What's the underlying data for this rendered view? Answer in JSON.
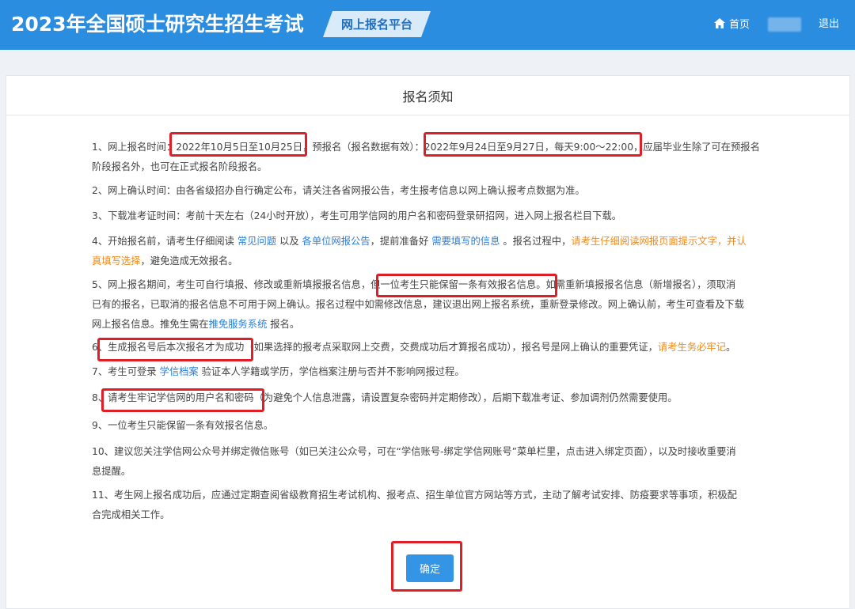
{
  "header": {
    "title": "2023年全国硕士研究生招生考试",
    "platform": "网上报名平台",
    "home_label": "首页",
    "logout_label": "退出"
  },
  "panel": {
    "title": "报名须知"
  },
  "notice": {
    "i1": {
      "a": "1、网上报名时间：",
      "b": "2022年10月5日至10月25日，",
      "c": "预报名（报名数据有效）：",
      "d": "2022年9月24日至9月27日，每天9:00～22:00，",
      "e": "应届毕业生除了可在预报名",
      "l2": "阶段报名外，也可在正式报名阶段报名。"
    },
    "i2": "2、网上确认时间：由各省级招办自行确定公布，请关注各省网报公告，考生报考信息以网上确认报考点数据为准。",
    "i3": "3、下载准考证时间：考前十天左右（24小时开放），考生可用学信网的用户名和密码登录研招网，进入网上报名栏目下载。",
    "i4": {
      "a": "4、开始报名前，请考生仔细阅读 ",
      "link1": "常见问题",
      "b": " 以及 ",
      "link2": "各单位网报公告",
      "c": "，提前准备好 ",
      "link3": "需要填写的信息",
      "d": " 。报名过程中，",
      "warn1": "请考生仔细阅读网报页面提示文字，并认",
      "warn2": "真填写选择",
      "e": "，避免造成无效报名。"
    },
    "i5": {
      "a": "5、网上报名期间，考生可自行填报、修改或重新填报报名信息，",
      "b": "但一位考生只能保留一条有效报名信息。",
      "c": "如需重新填报报名信息（新增报名），须取消",
      "l2": "已有的报名，已取消的报名信息不可用于网上确认。报名过程中如需修改信息，建议退出网上报名系统，重新登录修改。网上确认前，考生可查看及下载",
      "l3a": "网上报名信息。推免生需在",
      "link": "推免服务系统",
      "l3b": " 报名。"
    },
    "i6": {
      "a": "6、",
      "b": "生成报名号后本次报名才为成功",
      "c": "（如果选择的报考点采取网上交费，交费成功后才算报名成功），报名号是网上确认的重要凭证，",
      "warn": "请考生务必牢记",
      "d": "。"
    },
    "i7": {
      "a": "7、考生可登录 ",
      "link": "学信档案",
      "b": " 验证本人学籍或学历，学信档案注册与否并不影响网报过程。"
    },
    "i8": {
      "a": "8、",
      "b": "请考生牢记学信网的用户名和密码",
      "c": "（为避免个人信息泄露，请设置复杂密码并定期修改），后期下载准考证、参加调剂仍然需要使用。"
    },
    "i9": "9、一位考生只能保留一条有效报名信息。",
    "i10": {
      "l1": "10、建议您关注学信网公众号并绑定微信账号（如已关注公众号，可在“学信账号-绑定学信网账号”菜单栏里，点击进入绑定页面），以及时接收重要消",
      "l2": "息提醒。"
    },
    "i11": {
      "l1": "11、考生网上报名成功后，应通过定期查阅省级教育招生考试机构、报考点、招生单位官方网站等方式，主动了解考试安排、防疫要求等事项，积极配",
      "l2": "合完成相关工作。"
    }
  },
  "confirm_label": "确定",
  "colors": {
    "header_bg": "#2b8de0",
    "link": "#2b7fd6",
    "warn": "#f08a1c",
    "highlight": "#e01e26",
    "button": "#3494e6"
  }
}
